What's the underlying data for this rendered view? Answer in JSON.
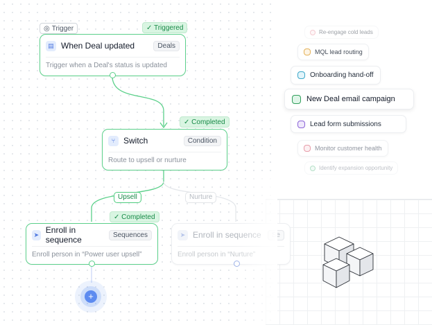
{
  "workflow": {
    "trigger_pill": {
      "icon": "target-icon",
      "label": "Trigger"
    },
    "nodes": {
      "trigger": {
        "status": "✓ Triggered",
        "title": "When Deal updated",
        "tag": "Deals",
        "description": "Trigger when a Deal's status is updated",
        "icon": "deal-icon"
      },
      "switch": {
        "status": "✓ Completed",
        "title": "Switch",
        "tag": "Condition",
        "description": "Route to upsell or nurture",
        "icon": "branch-icon"
      },
      "enroll_upsell": {
        "status": "✓ Completed",
        "title": "Enroll in sequence",
        "tag": "Sequences",
        "description": "Enroll person in “Power user upsell”",
        "icon": "send-icon"
      },
      "enroll_nurture": {
        "title": "Enroll in sequence",
        "tag": "Se",
        "description": "Enroll person in “Nurture”",
        "icon": "send-icon"
      }
    },
    "edges": {
      "upsell": "Upsell",
      "nurture": "Nurture"
    },
    "add_button": "+"
  },
  "campaigns": [
    {
      "label": "Re-engage cold leads",
      "icon_color": "#e88b9b",
      "icon_bg": "#fdecef"
    },
    {
      "label": "MQL lead routing",
      "icon_color": "#e0a43a",
      "icon_bg": "#fdf3e1"
    },
    {
      "label": "Onboarding hand-off",
      "icon_color": "#3aa7c9",
      "icon_bg": "#e2f4fa"
    },
    {
      "label": "New Deal email campaign",
      "icon_color": "#2f9e5a",
      "icon_bg": "#dff5e8"
    },
    {
      "label": "Lead form submissions",
      "icon_color": "#8a62d6",
      "icon_bg": "#efe8fb"
    },
    {
      "label": "Monitor customer health",
      "icon_color": "#e07a8c",
      "icon_bg": "#fcebee"
    },
    {
      "label": "Identify expansion opportunity",
      "icon_color": "#5dbb86",
      "icon_bg": "#e4f6ec"
    }
  ],
  "colors": {
    "accent_green": "#5bd08a",
    "accent_blue": "#5d8bf0"
  }
}
